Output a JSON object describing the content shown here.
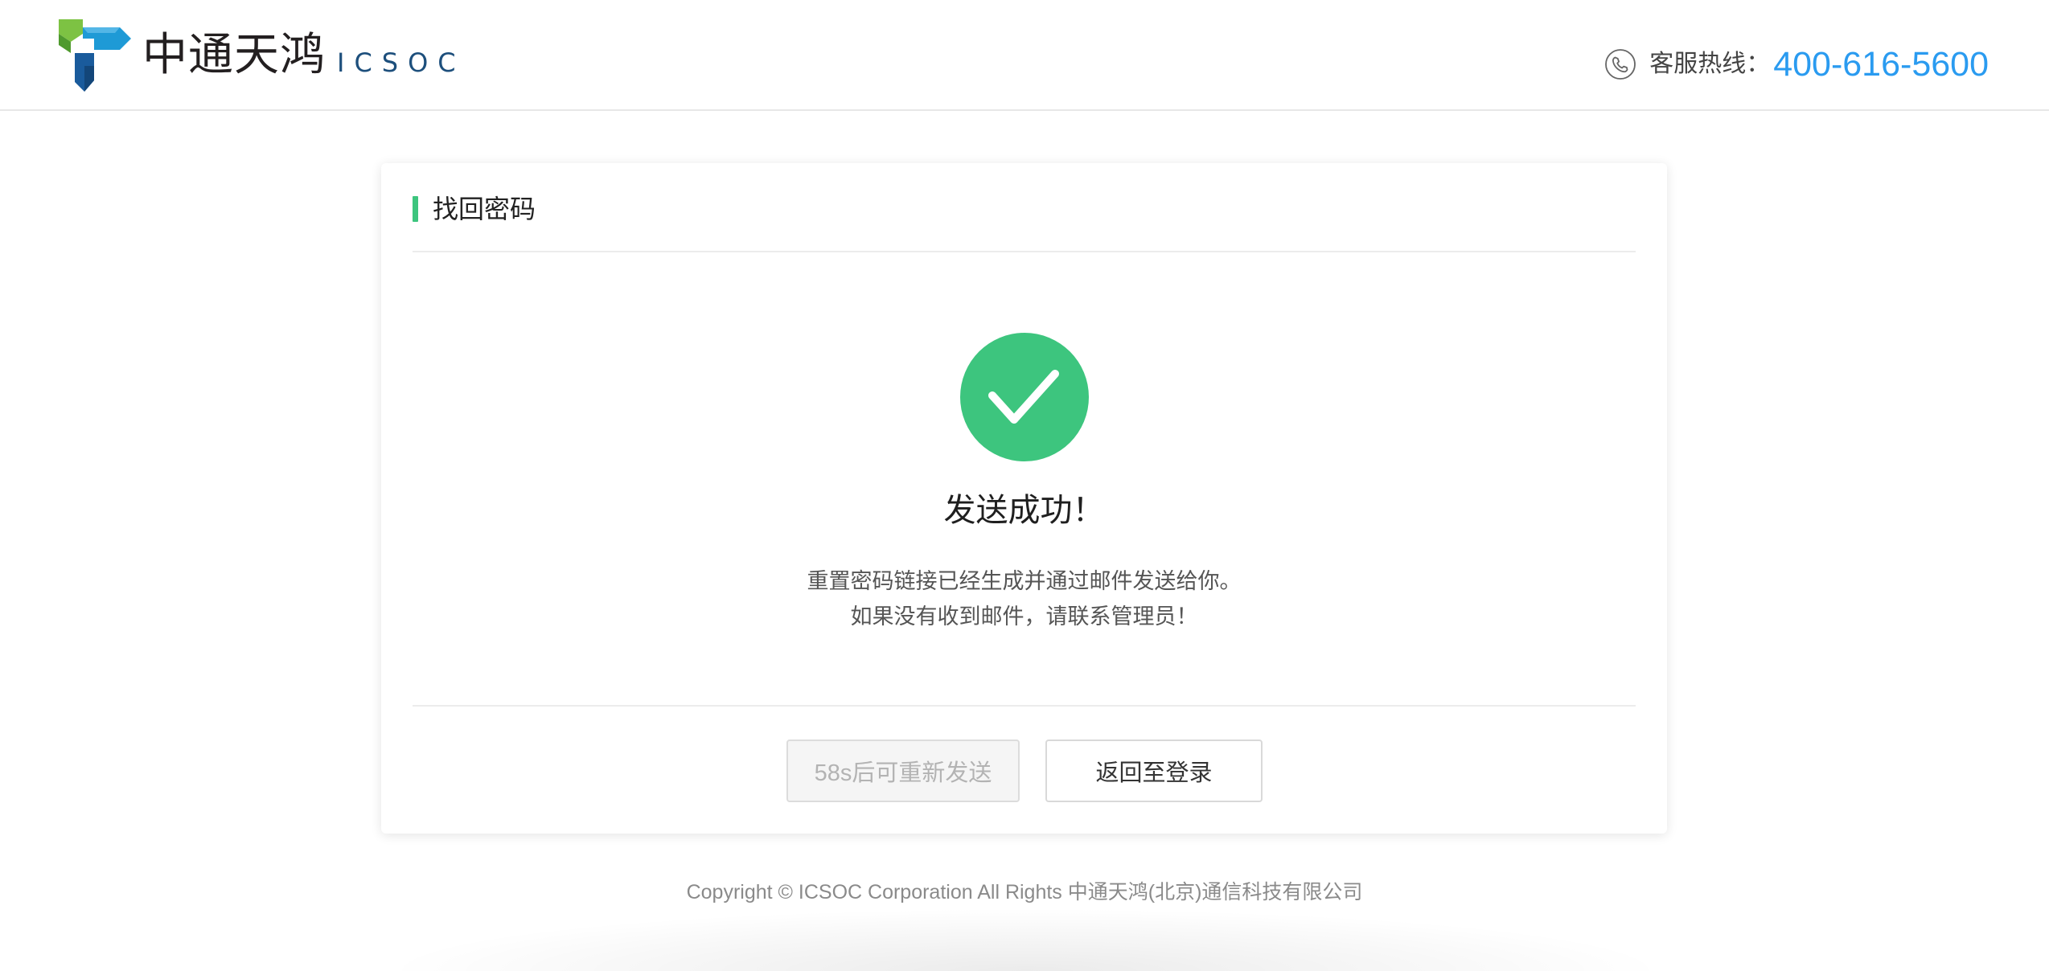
{
  "header": {
    "logo": {
      "name_cn": "中通天鸿",
      "name_en": "ICSOC"
    },
    "hotline_label": "客服热线：",
    "hotline_number": "400-616-5600"
  },
  "card": {
    "title": "找回密码",
    "success_title": "发送成功！",
    "message_lines": [
      "重置密码链接已经生成并通过邮件发送给你。",
      "如果没有收到邮件，请联系管理员！"
    ],
    "resend_button": "58s后可重新发送",
    "back_button": "返回至登录"
  },
  "footer": {
    "copyright": "Copyright © ICSOC Corporation All Rights 中通天鸿(北京)通信科技有限公司"
  },
  "icons": {
    "hotline": "phone-icon",
    "status": "check-circle-icon"
  },
  "colors": {
    "accent_green": "#3dc57e",
    "hotline_blue": "#2a9bf0"
  }
}
